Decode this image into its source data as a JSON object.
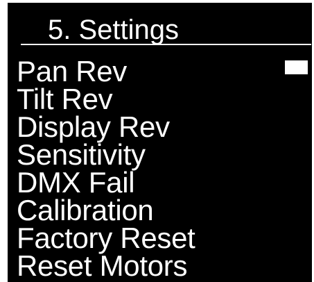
{
  "screen": {
    "title": "5. Settings",
    "menu_items": [
      "Pan Rev",
      "Tilt Rev",
      "Display Rev",
      "Sensitivity",
      "DMX Fail",
      "Calibration",
      "Factory Reset",
      "Reset Motors"
    ],
    "selected_index": 0,
    "colors": {
      "background": "#000000",
      "foreground": "#ffffff",
      "frame": "#ffffff"
    }
  }
}
